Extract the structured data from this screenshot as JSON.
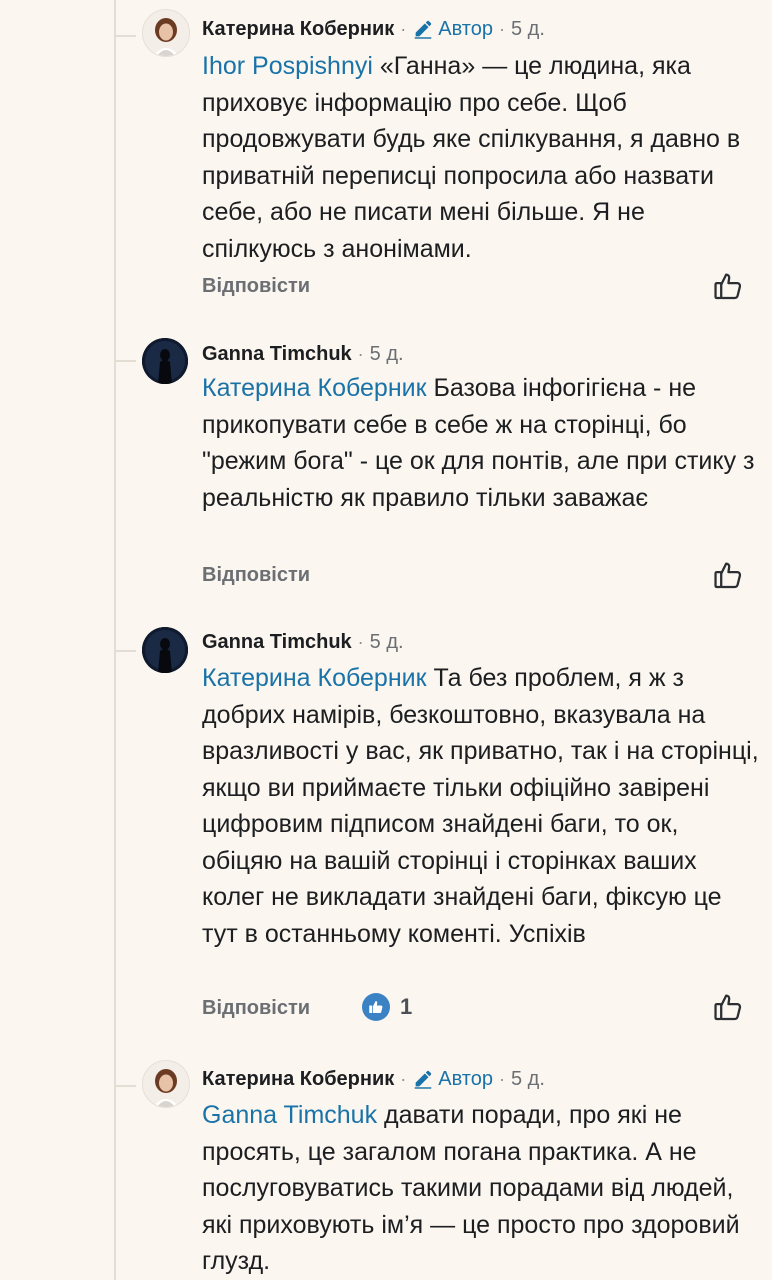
{
  "comments": [
    {
      "author": "Катерина Коберник",
      "badge": "Автор",
      "time": "5 д.",
      "mention": "Ihor Pospishnyi",
      "text": " «Ганна» — це людина, яка приховує інформацію про себе. Щоб продовжувати будь яке спілкування, я давно в приватній переписці попросила або назвати себе, або не писати мені більше. Я не спілкуюсь з анонімами.",
      "reply": "Відповісти"
    },
    {
      "author": "Ganna Timchuk",
      "time": "5 д.",
      "mention": "Катерина Коберник",
      "text": " Базова інфогігієна - не прикопувати себе в себе ж на сторінці, бо \"режим бога\" - це ок для понтів, але при стику з реальністю як правило тільки заважає",
      "reply": "Відповісти"
    },
    {
      "author": "Ganna Timchuk",
      "time": "5 д.",
      "mention": "Катерина Коберник",
      "text": " Та без проблем, я ж з добрих намірів, безкоштовно, вказувала на вразливості у вас, як приватно, так і на сторінці, якщо ви приймаєте тільки офіційно завірені цифровим підписом знайдені баги, то   ок, обіцяю на вашій сторінці і сторінках ваших колег не викладати знайдені баги, фіксую це тут в останньому коменті. Успіхів",
      "reply": "Відповісти",
      "reactions": "1"
    },
    {
      "author": "Катерина Коберник",
      "badge": "Автор",
      "time": "5 д.",
      "mention": "Ganna Timchuk",
      "text": " давати поради, про які не просять, це загалом погана практика. А не послуговуватись такими порадами від людей, які приховують ім’я — це просто про здоровий глузд."
    }
  ],
  "icons": {
    "author_badge": "pencil-icon",
    "like": "thumbs-up-icon",
    "reaction": "like-reaction-icon"
  },
  "colors": {
    "background": "#fbf6ef",
    "mention": "#1a73a8",
    "reaction": "#3b82c4"
  }
}
